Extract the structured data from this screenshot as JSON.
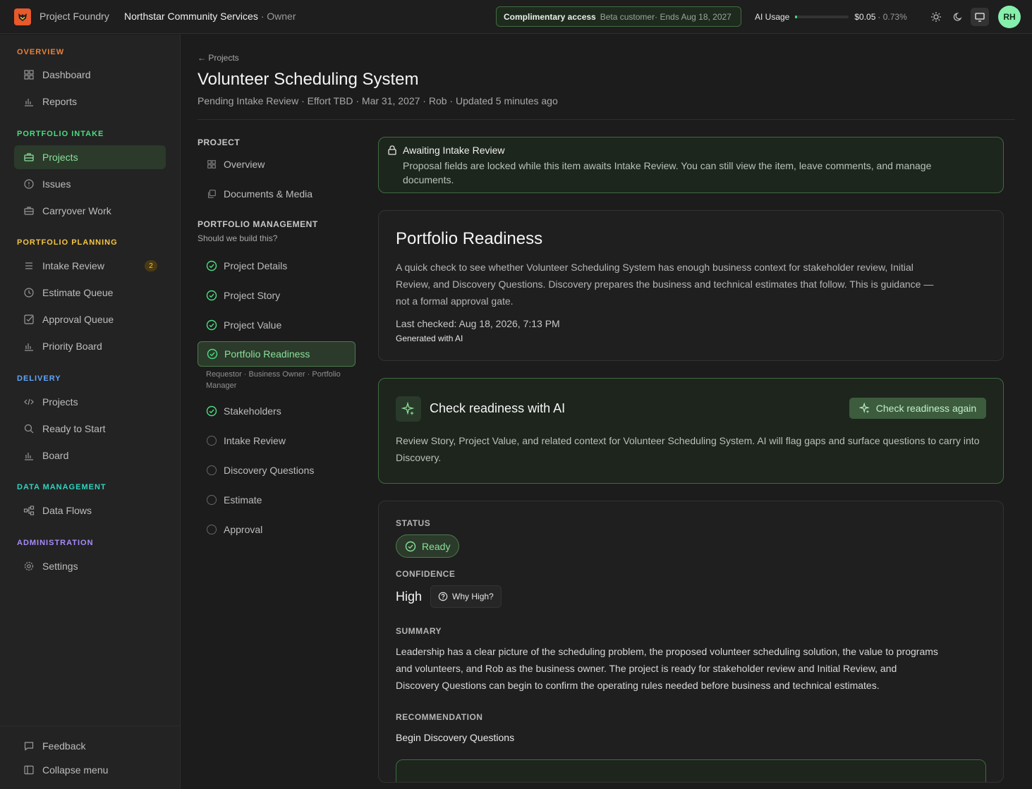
{
  "topbar": {
    "app_name": "Project Foundry",
    "org_name": "Northstar Community Services",
    "org_role": " · Owner",
    "access_label": "Complimentary access",
    "access_tier": "Beta customer",
    "access_ends": " · Ends Aug 18, 2027",
    "ai_usage_label": "AI Usage",
    "ai_usage_fraction": 0.0073,
    "ai_usage_cost": "$0.05",
    "ai_usage_pct": "· 0.73%",
    "avatar_initials": "RH"
  },
  "sidebar": {
    "sections": [
      {
        "title": "OVERVIEW",
        "color": "#e8823a"
      },
      {
        "title": "PORTFOLIO INTAKE",
        "color": "#4ade80"
      },
      {
        "title": "PORTFOLIO PLANNING",
        "color": "#f5c542"
      },
      {
        "title": "DELIVERY",
        "color": "#60a5fa"
      },
      {
        "title": "DATA MANAGEMENT",
        "color": "#2dd4bf"
      },
      {
        "title": "ADMINISTRATION",
        "color": "#a78bfa"
      }
    ],
    "items": {
      "dashboard": "Dashboard",
      "reports": "Reports",
      "projects": "Projects",
      "issues": "Issues",
      "carryover": "Carryover Work",
      "intake_review": "Intake Review",
      "intake_review_badge": "2",
      "estimate_queue": "Estimate Queue",
      "approval_queue": "Approval Queue",
      "priority_board": "Priority Board",
      "delivery_projects": "Projects",
      "ready_to_start": "Ready to Start",
      "board": "Board",
      "data_flows": "Data Flows",
      "settings": "Settings",
      "feedback": "Feedback",
      "collapse": "Collapse menu"
    }
  },
  "header": {
    "back": "← Projects",
    "title": "Volunteer Scheduling System",
    "meta": "Pending Intake Review · Effort TBD · Mar 31, 2027 · Rob · Updated 5 minutes ago"
  },
  "subnav": {
    "project_title": "PROJECT",
    "overview": "Overview",
    "documents": "Documents & Media",
    "pm_title": "PORTFOLIO MANAGEMENT",
    "pm_subtitle": "Should we build this?",
    "project_details": "Project Details",
    "project_story": "Project Story",
    "project_value": "Project Value",
    "portfolio_readiness": "Portfolio Readiness",
    "readiness_roles": "Requestor · Business Owner · Portfolio Manager",
    "stakeholders": "Stakeholders",
    "intake_review": "Intake Review",
    "discovery_questions": "Discovery Questions",
    "estimate": "Estimate",
    "approval": "Approval"
  },
  "alert": {
    "title": "Awaiting Intake Review",
    "body": "Proposal fields are locked while this item awaits Intake Review. You can still view the item, leave comments, and manage documents."
  },
  "readiness": {
    "title": "Portfolio Readiness",
    "description": "A quick check to see whether Volunteer Scheduling System has enough business context for stakeholder review, Initial Review, and Discovery Questions. Discovery prepares the business and technical estimates that follow. This is guidance — not a formal approval gate.",
    "last_checked": "Last checked: Aug 18, 2026, 7:13 PM",
    "generated": "Generated with AI"
  },
  "ai_check": {
    "title": "Check readiness with AI",
    "button": "Check readiness again",
    "description": "Review Story, Project Value, and related context for Volunteer Scheduling System. AI will flag gaps and surface questions to carry into Discovery."
  },
  "status": {
    "status_label": "STATUS",
    "status_value": "Ready",
    "confidence_label": "CONFIDENCE",
    "confidence_value": "High",
    "why_button": "Why High?",
    "summary_label": "SUMMARY",
    "summary": "Leadership has a clear picture of the scheduling problem, the proposed volunteer scheduling solution, the value to programs and volunteers, and Rob as the business owner. The project is ready for stakeholder review and Initial Review, and Discovery Questions can begin to confirm the operating rules needed before business and technical estimates.",
    "recommendation_label": "RECOMMENDATION",
    "recommendation": "Begin Discovery Questions"
  }
}
